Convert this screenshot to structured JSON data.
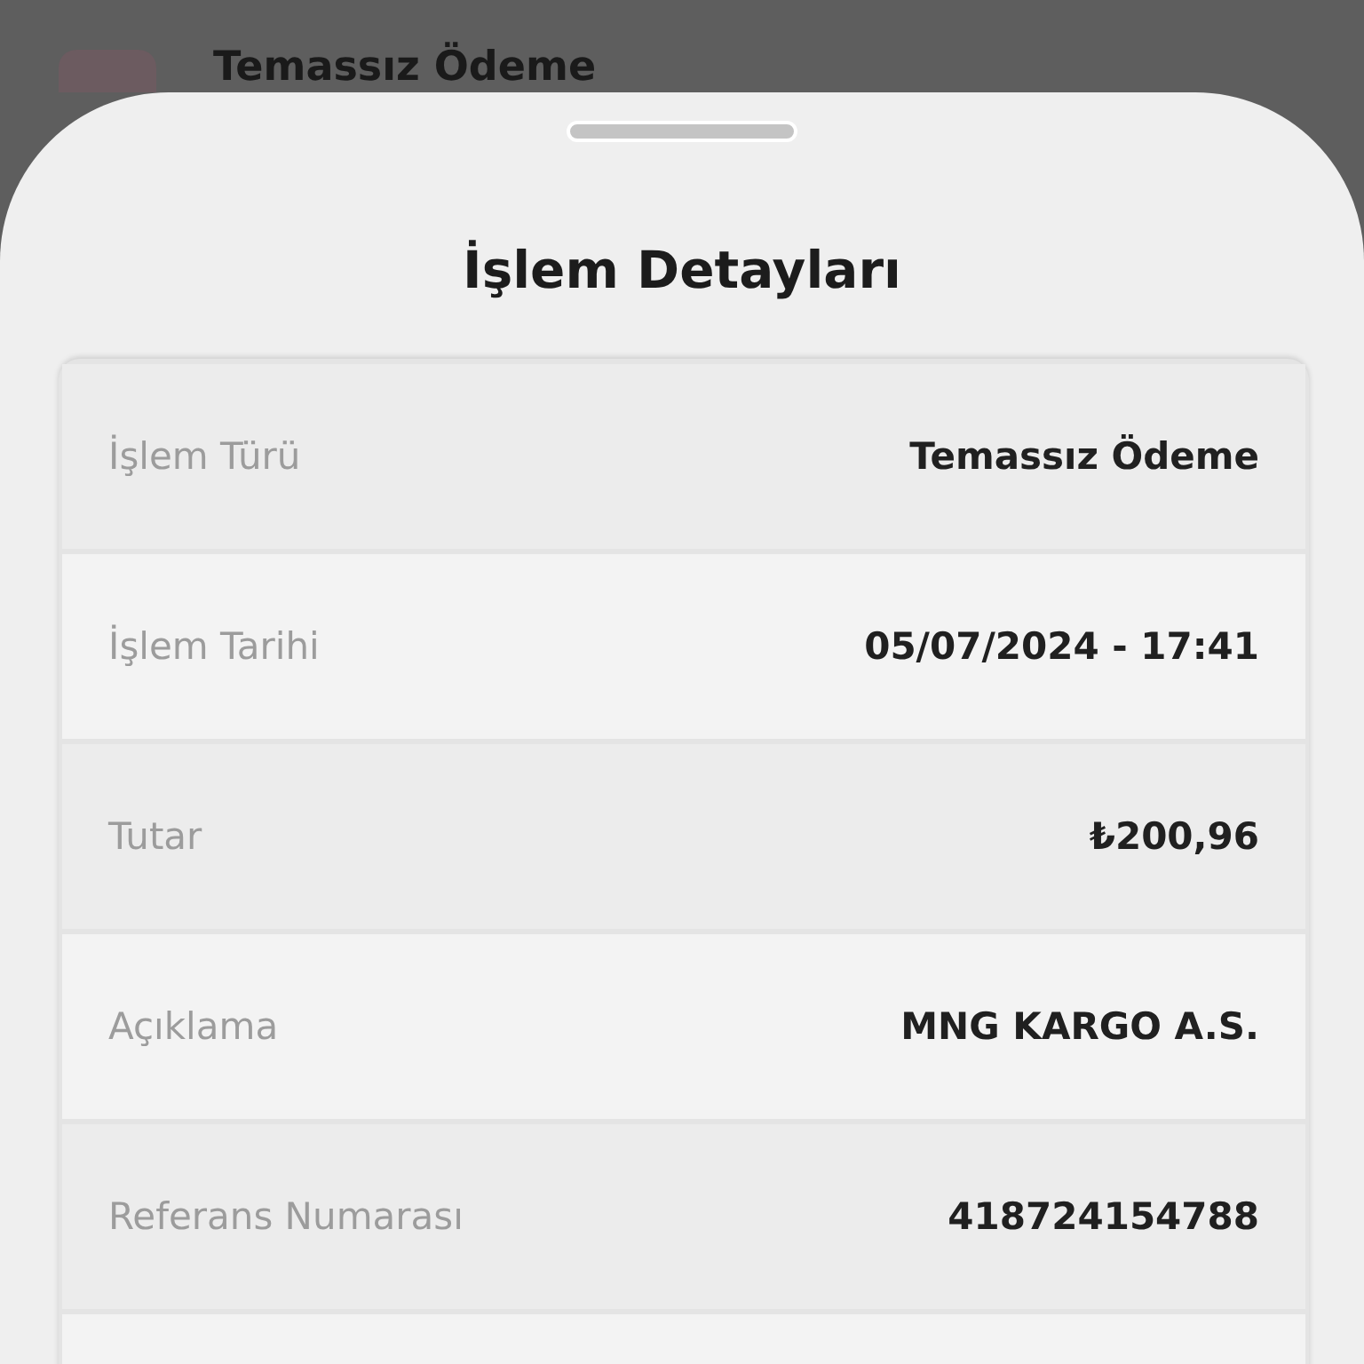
{
  "background_item": {
    "title": "Temassız Ödeme"
  },
  "sheet": {
    "title": "İşlem Detayları",
    "rows": [
      {
        "label": "İşlem Türü",
        "value": "Temassız Ödeme"
      },
      {
        "label": "İşlem Tarihi",
        "value": "05/07/2024 - 17:41"
      },
      {
        "label": "Tutar",
        "value": "₺200,96"
      },
      {
        "label": "Açıklama",
        "value": "MNG KARGO A.S."
      },
      {
        "label": "Referans Numarası",
        "value": "418724154788"
      }
    ]
  }
}
